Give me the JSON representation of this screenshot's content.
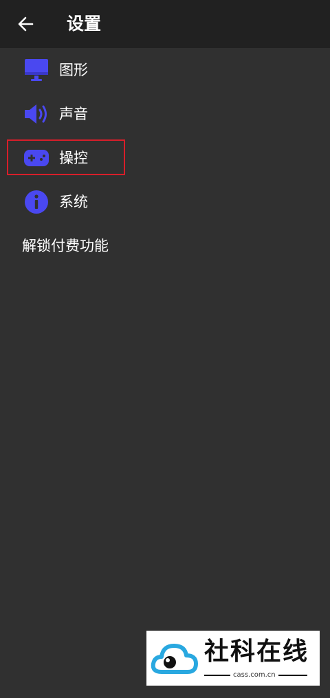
{
  "header": {
    "title": "设置",
    "back_icon": "arrow-left-icon"
  },
  "menu": {
    "items": [
      {
        "label": "图形",
        "icon": "monitor-icon"
      },
      {
        "label": "声音",
        "icon": "speaker-icon"
      },
      {
        "label": "操控",
        "icon": "gamepad-icon"
      },
      {
        "label": "系统",
        "icon": "info-icon"
      }
    ],
    "unlock_label": "解锁付费功能"
  },
  "colors": {
    "background": "#303030",
    "topbar": "#212121",
    "icon_accent": "#4a48f0",
    "highlight": "#d81e2a",
    "text": "#ffffff"
  },
  "watermark": {
    "brand": "社科在线",
    "url": "cass.com.cn"
  }
}
